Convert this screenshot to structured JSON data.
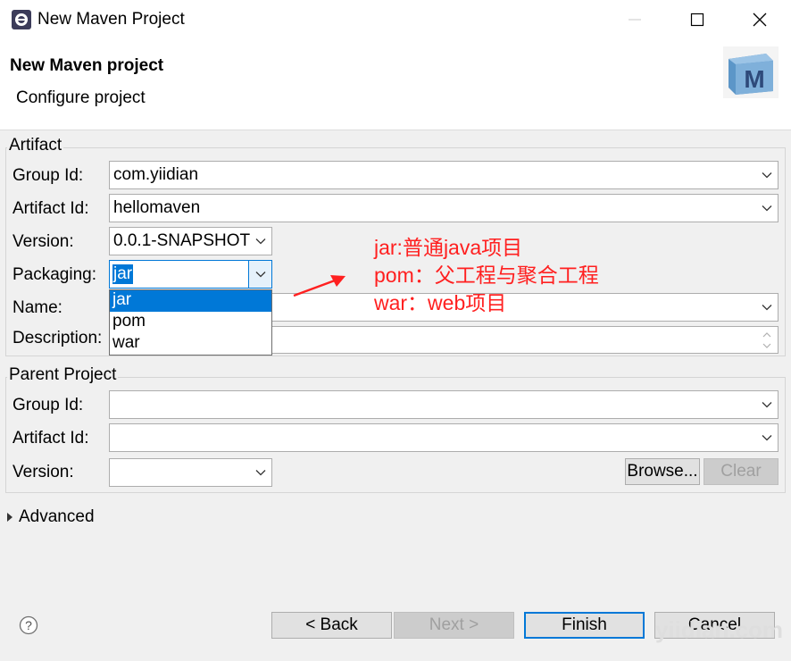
{
  "window": {
    "title": "New Maven Project"
  },
  "header": {
    "title": "New Maven project",
    "subtitle": "Configure project"
  },
  "artifact": {
    "section_label": "Artifact",
    "group_id_label": "Group Id:",
    "group_id_value": "com.yiidian",
    "artifact_id_label": "Artifact Id:",
    "artifact_id_value": "hellomaven",
    "version_label": "Version:",
    "version_value": "0.0.1-SNAPSHOT",
    "packaging_label": "Packaging:",
    "packaging_value": "jar",
    "packaging_options": [
      "jar",
      "pom",
      "war"
    ],
    "name_label": "Name:",
    "description_label": "Description:"
  },
  "parent": {
    "section_label": "Parent Project",
    "group_id_label": "Group Id:",
    "artifact_id_label": "Artifact Id:",
    "version_label": "Version:",
    "browse_label": "Browse...",
    "clear_label": "Clear"
  },
  "advanced": {
    "label": "Advanced"
  },
  "footer": {
    "help_icon": "?",
    "back_label": "< Back",
    "next_label": "Next >",
    "finish_label": "Finish",
    "cancel_label": "Cancel"
  },
  "annotation": {
    "line1": "jar:普通java项目",
    "line2": "pom：父工程与聚合工程",
    "line3": "war：web项目"
  },
  "watermark": "yiidian.com",
  "colors": {
    "selection": "#0078d7",
    "annotation": "#ff2020",
    "panel": "#f0f0f0"
  }
}
